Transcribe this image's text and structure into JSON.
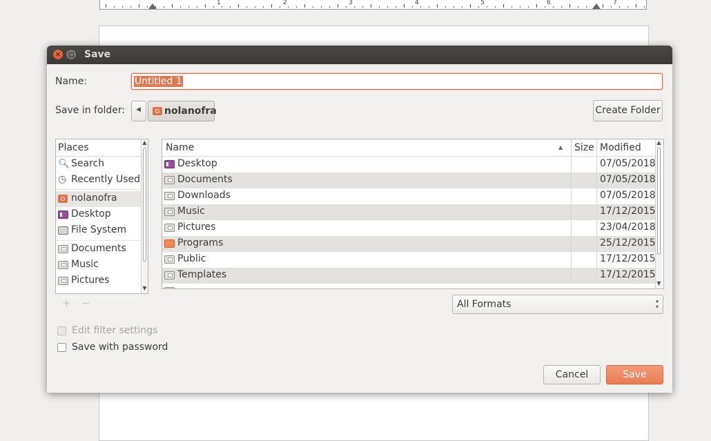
{
  "ruler": {
    "numbers": [
      "1",
      "2",
      "3",
      "4",
      "5",
      "6",
      "7"
    ]
  },
  "dialog": {
    "title": "Save",
    "name_label": "Name:",
    "name_value": "Untitled 1",
    "folder_label": "Save in folder:",
    "folder_path": "nolanofra",
    "create_folder": "Create Folder",
    "places": {
      "header": "Places",
      "items": [
        {
          "label": "Search",
          "icon": "search-icon"
        },
        {
          "label": "Recently Used",
          "icon": "recent-icon"
        },
        {
          "label": "nolanofra",
          "icon": "home-folder-icon"
        },
        {
          "label": "Desktop",
          "icon": "desktop-folder-icon"
        },
        {
          "label": "File System",
          "icon": "drive-icon"
        },
        {
          "label": "Documents",
          "icon": "documents-folder-icon"
        },
        {
          "label": "Music",
          "icon": "music-folder-icon"
        },
        {
          "label": "Pictures",
          "icon": "pictures-folder-icon"
        }
      ],
      "add": "+",
      "remove": "−"
    },
    "files": {
      "columns": {
        "name": "Name",
        "size": "Size",
        "modified": "Modified"
      },
      "rows": [
        {
          "name": "Desktop",
          "modified": "07/05/2018"
        },
        {
          "name": "Documents",
          "modified": "07/05/2018"
        },
        {
          "name": "Downloads",
          "modified": "07/05/2018"
        },
        {
          "name": "Music",
          "modified": "17/12/2015"
        },
        {
          "name": "Pictures",
          "modified": "23/04/2018"
        },
        {
          "name": "Programs",
          "modified": "25/12/2015"
        },
        {
          "name": "Public",
          "modified": "17/12/2015"
        },
        {
          "name": "Templates",
          "modified": "17/12/2015"
        }
      ]
    },
    "format": "All Formats",
    "edit_filter": "Edit filter settings",
    "save_with_password": "Save with password",
    "cancel": "Cancel",
    "save": "Save"
  },
  "colors": {
    "accent": "#e2724a",
    "titlebar": "#3c3b37",
    "close_button": "#e45a2e"
  }
}
